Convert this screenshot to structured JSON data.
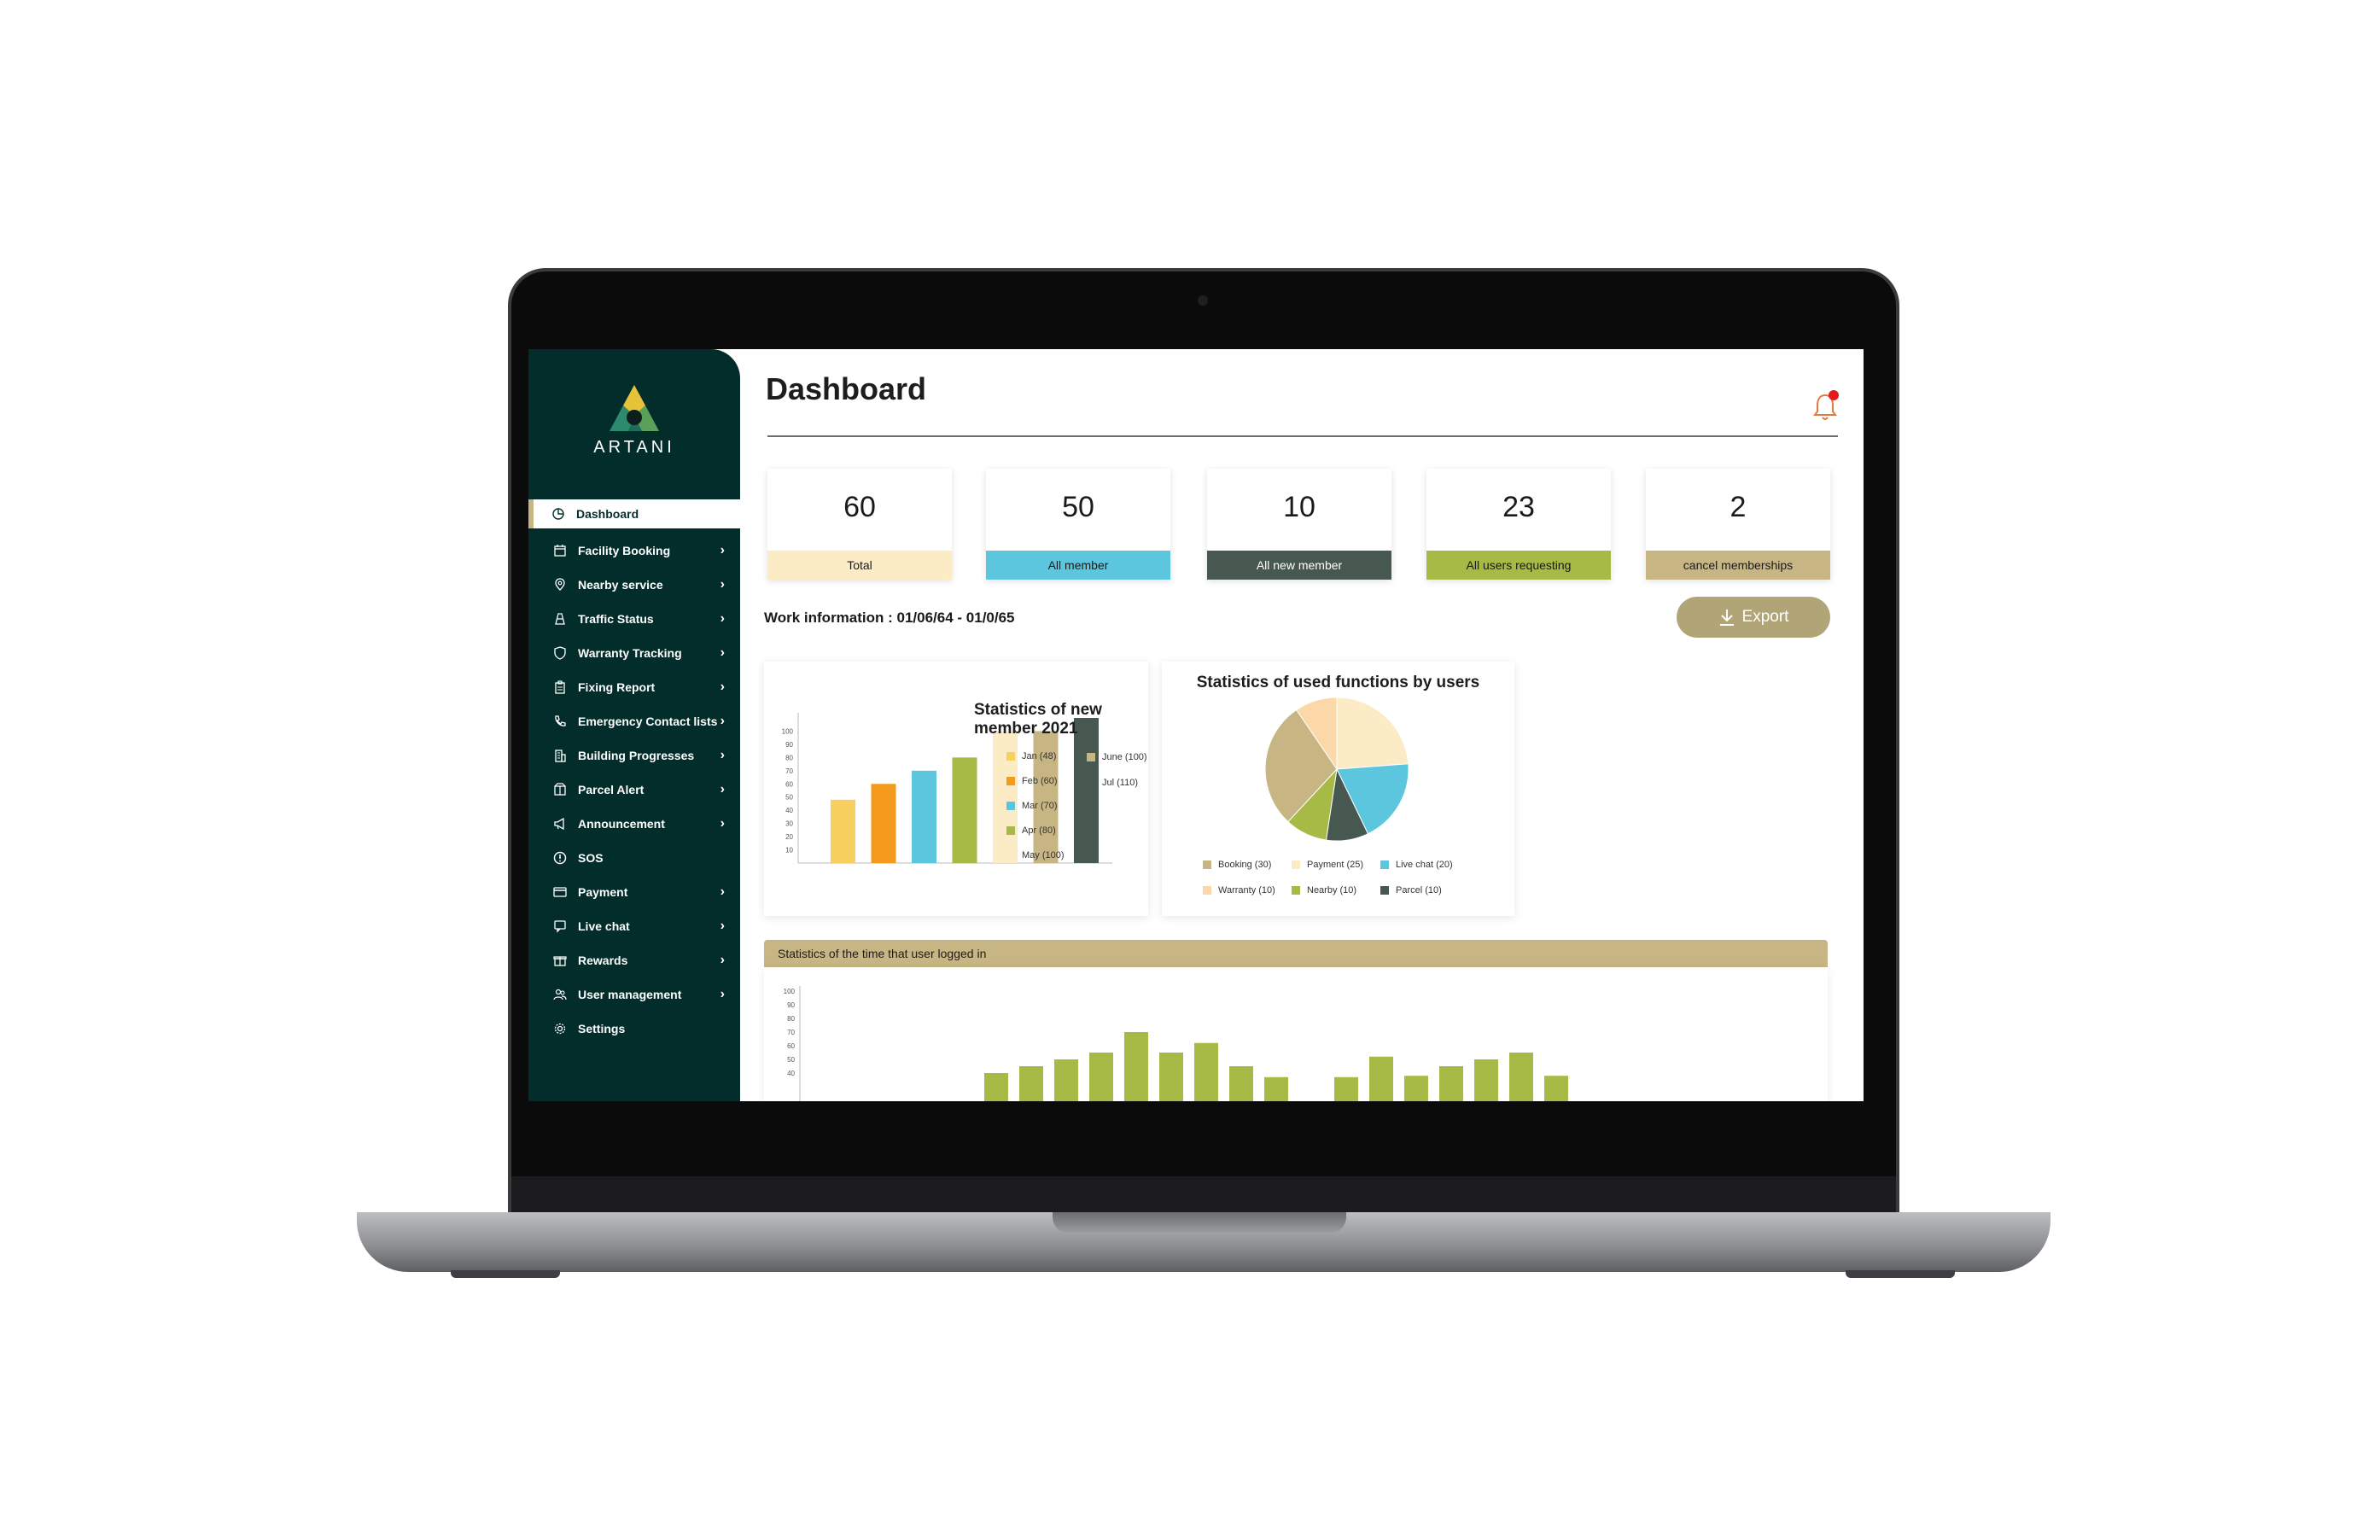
{
  "app": {
    "brand": "ARTANI",
    "page_title": "Dashboard"
  },
  "sidebar": {
    "items": [
      {
        "label": "Dashboard",
        "icon": "pie-chart-icon",
        "active": true,
        "chevron": false
      },
      {
        "label": "Facility Booking",
        "icon": "calendar-icon",
        "chevron": true
      },
      {
        "label": "Nearby service",
        "icon": "location-pin-icon",
        "chevron": true
      },
      {
        "label": "Traffic Status",
        "icon": "traffic-cone-icon",
        "chevron": true
      },
      {
        "label": "Warranty Tracking",
        "icon": "shield-icon",
        "chevron": true
      },
      {
        "label": "Fixing Report",
        "icon": "clipboard-icon",
        "chevron": true
      },
      {
        "label": "Emergency Contact lists",
        "icon": "phone-icon",
        "chevron": true
      },
      {
        "label": "Building Progresses",
        "icon": "building-icon",
        "chevron": true
      },
      {
        "label": "Parcel Alert",
        "icon": "parcel-icon",
        "chevron": true
      },
      {
        "label": "Announcement",
        "icon": "megaphone-icon",
        "chevron": true
      },
      {
        "label": "SOS",
        "icon": "alert-circle-icon",
        "chevron": false
      },
      {
        "label": "Payment",
        "icon": "credit-card-icon",
        "chevron": true
      },
      {
        "label": "Live chat",
        "icon": "chat-bubble-icon",
        "chevron": true
      },
      {
        "label": "Rewards",
        "icon": "gift-icon",
        "chevron": true
      },
      {
        "label": "User management",
        "icon": "users-icon",
        "chevron": true
      },
      {
        "label": "Settings",
        "icon": "gear-icon",
        "chevron": false
      }
    ],
    "chevron_glyph": "›"
  },
  "stats": [
    {
      "value": "60",
      "label": "Total",
      "color": "#fbecc6"
    },
    {
      "value": "50",
      "label": "All member",
      "color": "#5cc6de"
    },
    {
      "value": "10",
      "label": "All new member",
      "color": "#46584f",
      "label_color": "#ffffff"
    },
    {
      "value": "23",
      "label": "All users requesting",
      "color": "#a6ba45"
    },
    {
      "value": "2",
      "label": "cancel memberships",
      "color": "#c7b584"
    }
  ],
  "work_info": "Work information : 01/06/64 - 01/0/65",
  "export_label": "Export",
  "colors": {
    "sidebar_bg": "#032d2a",
    "accent_gold": "#c7b584",
    "export_btn": "#b1a578",
    "notification_dot": "#e21c1c"
  },
  "chart_data": [
    {
      "type": "bar",
      "title": "Statistics of new member 2021",
      "categories": [
        "Jan",
        "Feb",
        "Mar",
        "Apr",
        "May",
        "June",
        "Jul"
      ],
      "values": [
        48,
        60,
        70,
        80,
        100,
        100,
        110
      ],
      "colors": [
        "#f8d060",
        "#f39a1c",
        "#5cc6de",
        "#a6ba45",
        "#fbecc6",
        "#c7b584",
        "#46584f"
      ],
      "legend": [
        "Jan (48)",
        "Feb (60)",
        "Mar (70)",
        "Apr (80)",
        "May (100)",
        "June (100)",
        "Jul (110)"
      ],
      "yticks": [
        10,
        20,
        30,
        40,
        50,
        60,
        70,
        80,
        90,
        100
      ],
      "ylim": [
        0,
        110
      ],
      "legend_position": "right"
    },
    {
      "type": "pie",
      "title": "Statistics of used functions by users",
      "labels": [
        "Booking",
        "Payment",
        "Live chat",
        "Warranty",
        "Nearby",
        "Parcel"
      ],
      "values": [
        30,
        25,
        20,
        10,
        10,
        10
      ],
      "legend": [
        "Booking (30)",
        "Payment (25)",
        "Live chat (20)",
        "Warranty (10)",
        "Nearby (10)",
        "Parcel (10)"
      ],
      "colors": [
        "#c7b584",
        "#fbecc6",
        "#5cc6de",
        "#fcd8a8",
        "#a6ba45",
        "#46584f"
      ],
      "legend_position": "bottom"
    },
    {
      "type": "bar",
      "title": "Statistics of the time that user logged in",
      "values": [
        40,
        45,
        50,
        55,
        70,
        55,
        62,
        45,
        37,
        0,
        37,
        52,
        38,
        45,
        50,
        55,
        38
      ],
      "yticks": [
        40,
        50,
        60,
        70,
        80,
        90,
        100
      ],
      "ylim": [
        30,
        100
      ],
      "color": "#a6ba45"
    }
  ]
}
